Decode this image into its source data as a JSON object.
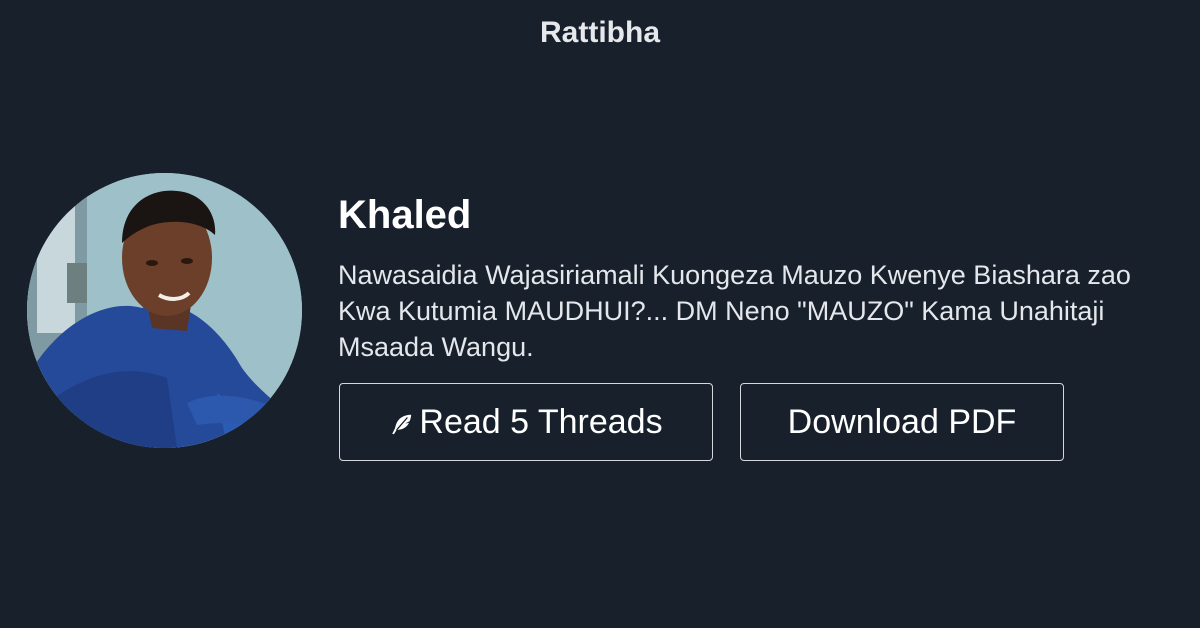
{
  "brand": {
    "name": "Rattibha"
  },
  "profile": {
    "name": "Khaled",
    "bio": "Nawasaidia Wajasiriamali Kuongeza Mauzo Kwenye Biashara zao Kwa Kutumia MAUDHUI?... DM Neno \"MAUZO\" Kama Unahitaji Msaada Wangu."
  },
  "actions": {
    "read_label": "Read 5 Threads",
    "read_icon": "feather-icon",
    "download_label": "Download PDF"
  },
  "colors": {
    "background": "#18202b",
    "text": "#ffffff",
    "button_border": "#d5d8dc"
  }
}
